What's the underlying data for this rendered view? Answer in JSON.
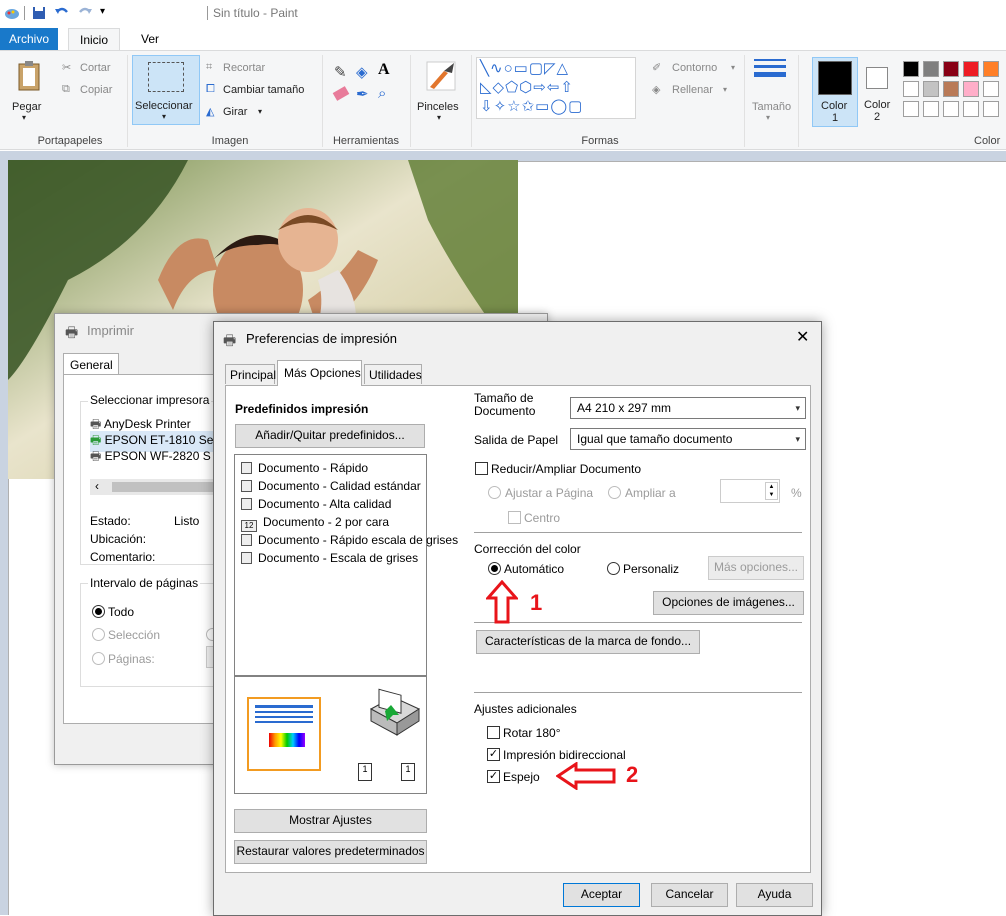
{
  "app": {
    "title": "Sin título - Paint"
  },
  "menu": {
    "tabs": [
      "Archivo",
      "Inicio",
      "Ver"
    ]
  },
  "ribbon": {
    "paste": "Pegar",
    "cut": "Cortar",
    "copy": "Copiar",
    "group_clipboard": "Portapapeles",
    "select": "Seleccionar",
    "crop": "Recortar",
    "resize": "Cambiar tamaño",
    "rotate": "Girar",
    "group_image": "Imagen",
    "group_tools": "Herramientas",
    "brushes": "Pinceles",
    "outline": "Contorno",
    "fill": "Rellenar",
    "group_shapes": "Formas",
    "size": "Tamaño",
    "color1": "Color",
    "color1_num": "1",
    "color2": "Color",
    "color2_num": "2",
    "group_colors": "Color",
    "palette": [
      "#000000",
      "#7f7f7f",
      "#880015",
      "#ed1c24",
      "#ff7f27",
      "#ffffff",
      "#c3c3c3",
      "#b97a57",
      "#ffaec9",
      "#ffffff"
    ]
  },
  "print_dialog": {
    "title": "Imprimir",
    "tab": "General",
    "select_printer": "Seleccionar impresora",
    "printers": [
      "AnyDesk Printer",
      "EPSON ET-1810 Se",
      "EPSON WF-2820 S"
    ],
    "status_label": "Estado:",
    "status_value": "Listo",
    "location_label": "Ubicación:",
    "comment_label": "Comentario:",
    "page_range": "Intervalo de páginas",
    "all": "Todo",
    "selection": "Selección",
    "pages": "Páginas:"
  },
  "pref_dialog": {
    "title": "Preferencias de impresión",
    "tabs": [
      "Principal",
      "Más Opciones",
      "Utilidades"
    ],
    "presets_title": "Predefinidos impresión",
    "add_remove": "Añadir/Quitar predefinidos...",
    "presets": [
      "Documento - Rápido",
      "Documento - Calidad estándar",
      "Documento - Alta calidad",
      "Documento - 2 por cara",
      "Documento - Rápido escala de grises",
      "Documento - Escala de grises"
    ],
    "show_settings": "Mostrar Ajustes",
    "restore": "Restaurar valores predeterminados",
    "doc_size_label": "Tamaño de Documento",
    "doc_size_value": "A4 210 x 297 mm",
    "paper_out_label": "Salida de Papel",
    "paper_out_value": "Igual que tamaño documento",
    "reduce": "Reducir/Ampliar Documento",
    "fit_page": "Ajustar a Página",
    "zoom": "Ampliar a",
    "percent": "%",
    "center": "Centro",
    "color_corr": "Corrección del color",
    "auto": "Automático",
    "custom": "Personaliz",
    "more_opts": "Más opciones...",
    "image_opts": "Opciones de imágenes...",
    "watermark": "Características de la marca de fondo...",
    "extra": "Ajustes adicionales",
    "rotate180": "Rotar 180°",
    "bidir": "Impresión bidireccional",
    "mirror": "Espejo",
    "ok": "Aceptar",
    "cancel": "Cancelar",
    "help": "Ayuda",
    "annot1": "1",
    "annot2": "2"
  },
  "colors": {
    "accent": "#1979ca",
    "annotation": "#e8141a"
  }
}
